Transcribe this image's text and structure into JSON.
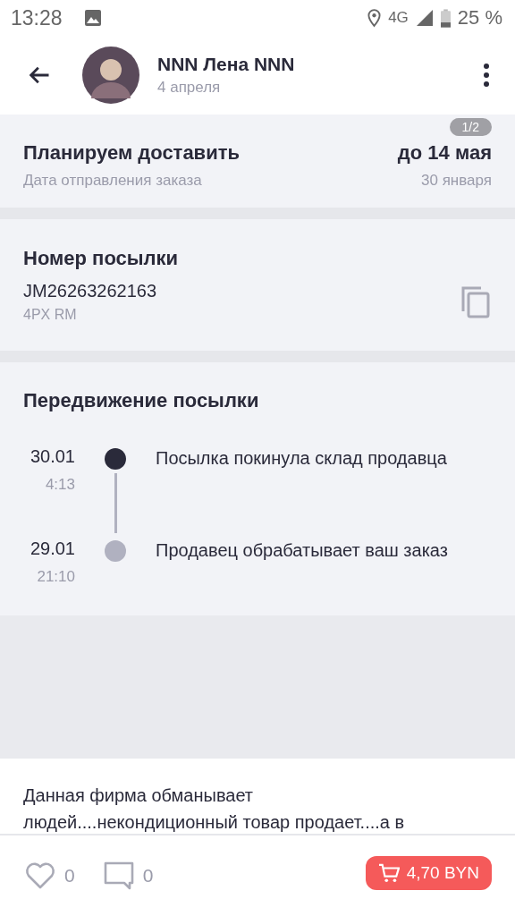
{
  "status_bar": {
    "time": "13:28",
    "network": "4G",
    "battery": "25 %"
  },
  "header": {
    "name": "NNN Лена NNN",
    "date": "4 апреля"
  },
  "delivery": {
    "title": "Планируем доставить",
    "date": "до 14 мая",
    "subtitle": "Дата отправления заказа",
    "sent_date": "30 января",
    "pager": "1/2"
  },
  "parcel": {
    "title": "Номер посылки",
    "number": "JM26263262163",
    "service": "4PX RM"
  },
  "tracking": {
    "title": "Передвижение посылки",
    "events": [
      {
        "date": "30.01",
        "time": "4:13",
        "text": "Посылка покинула склад продавца",
        "current": true
      },
      {
        "date": "29.01",
        "time": "21:10",
        "text": "Продавец обрабатывает ваш заказ",
        "current": false
      }
    ]
  },
  "comment": {
    "text": "Данная фирма обманывает людей....некондиционный товар продает....а в"
  },
  "footer": {
    "likes": "0",
    "comments": "0",
    "price": "4,70 BYN"
  }
}
